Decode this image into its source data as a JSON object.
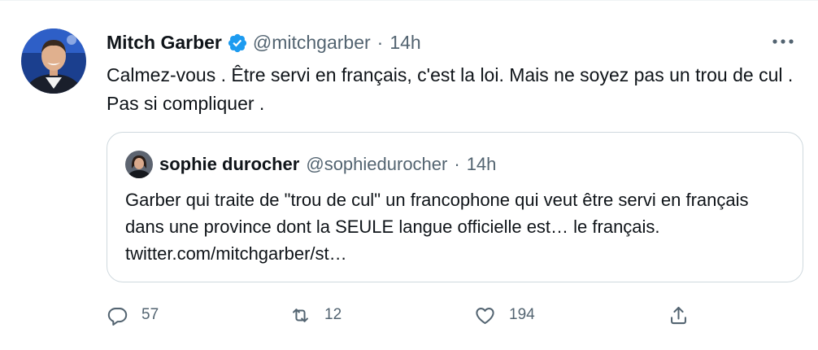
{
  "tweet": {
    "author_name": "Mitch Garber",
    "author_handle": "@mitchgarber",
    "separator": "·",
    "time": "14h",
    "text": "Calmez-vous . Être servi en français, c'est la loi. Mais ne soyez pas un trou de cul . Pas si compliquer .",
    "more_icon": "more-dots-icon",
    "verified_icon": "verified-badge-icon"
  },
  "quote": {
    "author_name": "sophie durocher",
    "author_handle": "@sophiedurocher",
    "separator": "·",
    "time": "14h",
    "text": "Garber qui traite de \"trou de cul\" un francophone qui veut être servi en français dans une province dont la SEULE langue officielle est… le français. twitter.com/mitchgarber/st…"
  },
  "actions": {
    "reply_count": "57",
    "retweet_count": "12",
    "like_count": "194",
    "reply_icon": "reply-icon",
    "retweet_icon": "retweet-icon",
    "like_icon": "heart-icon",
    "share_icon": "share-icon"
  },
  "colors": {
    "text": "#0f1419",
    "secondary": "#536471",
    "verified": "#1d9bf0",
    "border": "#cfd9de"
  }
}
